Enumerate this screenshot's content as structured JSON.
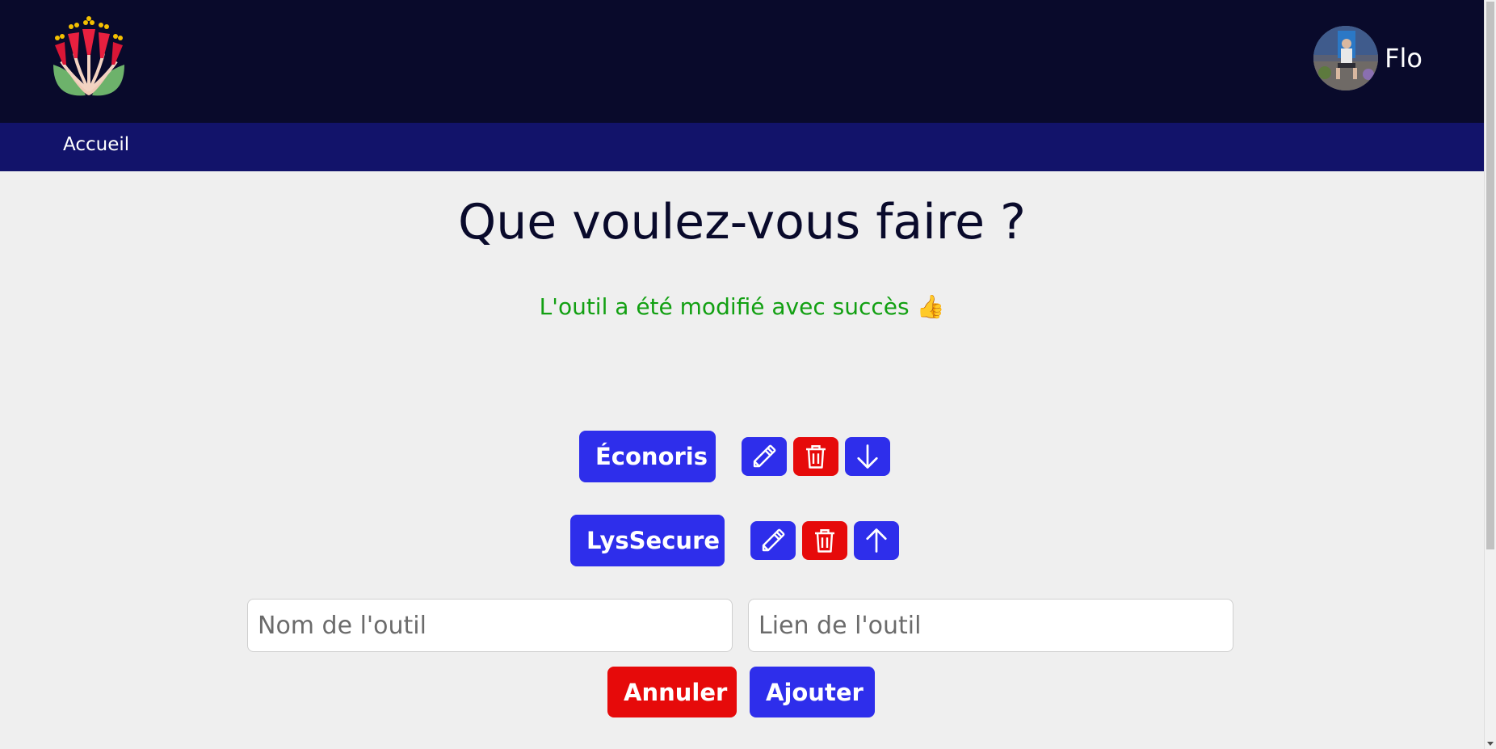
{
  "header": {
    "user": {
      "name": "Flo",
      "avatar_alt": "Flo"
    }
  },
  "nav": {
    "home_label": "Accueil"
  },
  "main": {
    "title": "Que voulez-vous faire ?",
    "success_message": "L'outil a été modifié avec succès 👍",
    "tools": [
      {
        "name": "Éconoris",
        "move_icon": "arrow-down-icon"
      },
      {
        "name": "LysSecure",
        "move_icon": "arrow-up-icon"
      }
    ],
    "form": {
      "name_placeholder": "Nom de l'outil",
      "link_placeholder": "Lien de l'outil",
      "cancel_label": "Annuler",
      "add_label": "Ajouter"
    }
  },
  "colors": {
    "header_bg": "#090a2b",
    "nav_bg": "#12136a",
    "primary": "#2e2eeb",
    "danger": "#e60a0a",
    "success": "#12a012"
  }
}
